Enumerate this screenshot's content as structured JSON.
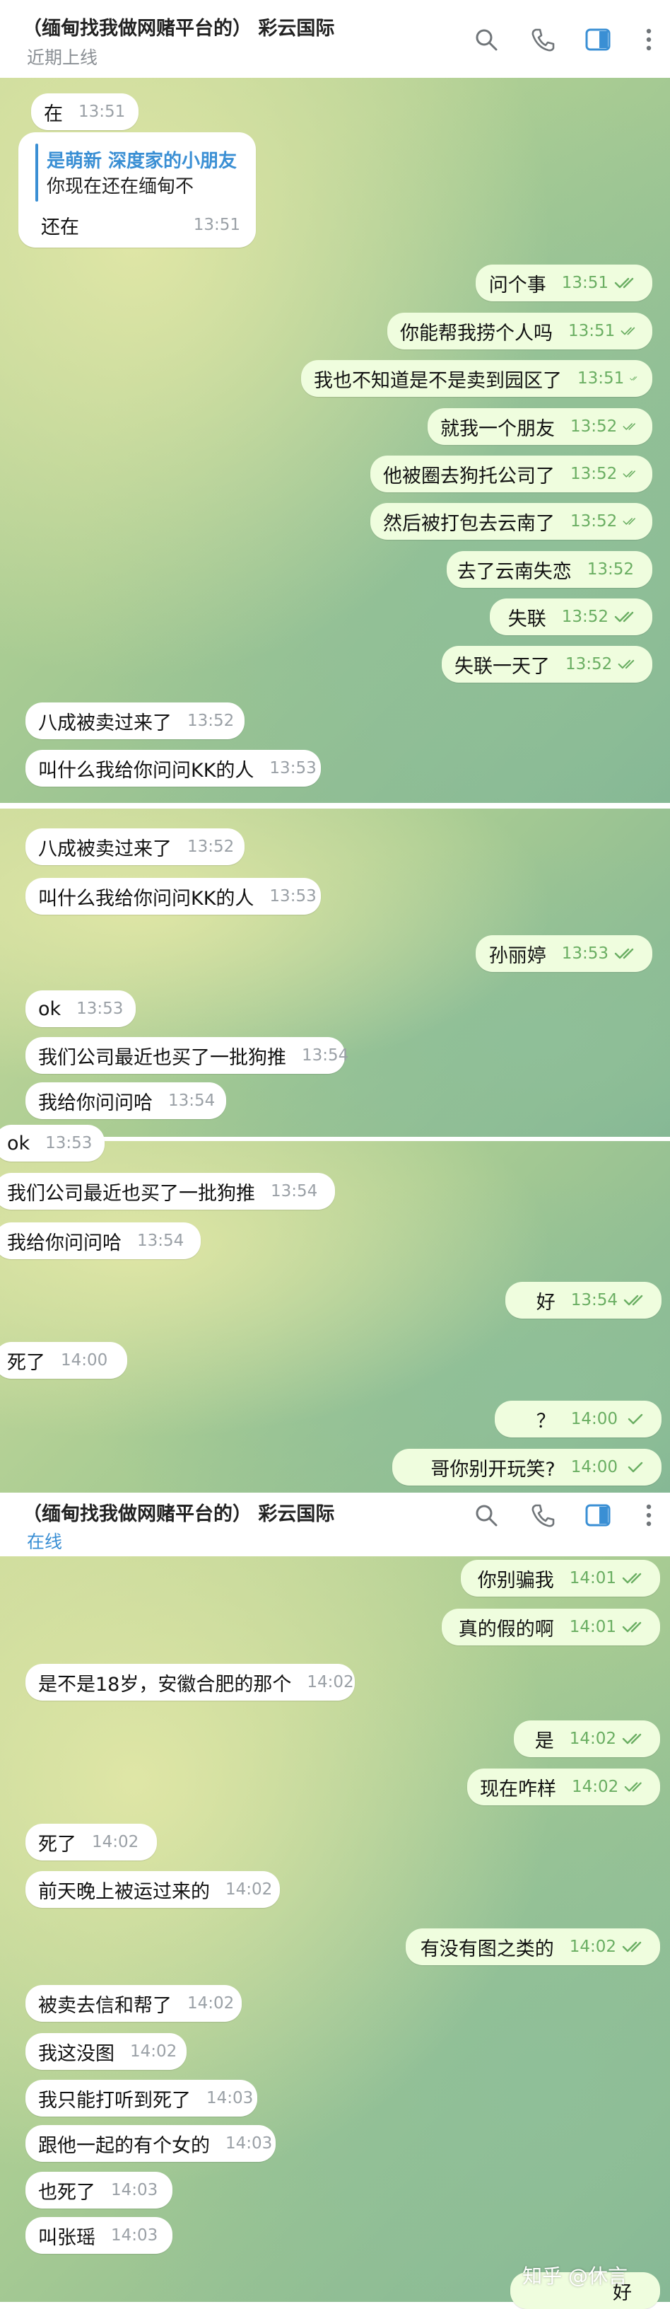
{
  "chat_title": "（缅甸找我做网赌平台的） 彩云国际",
  "status_top": "近期上线",
  "status_bottom": "在线",
  "header_icons": [
    "search-icon",
    "phone-icon",
    "sidebar-toggle-icon",
    "more-icon"
  ],
  "accent_color": "#3a8fd4",
  "reply_quote": {
    "name": "是萌新 深度家的小朋友",
    "text": "你现在还在缅甸不",
    "reply": "还在",
    "time": "13:51"
  },
  "seg1": [
    {
      "text": "在",
      "time": "13:51",
      "dir": "in"
    },
    {
      "text": "问个事",
      "time": "13:51",
      "dir": "out"
    },
    {
      "text": "你能帮我捞个人吗",
      "time": "13:51",
      "dir": "out"
    },
    {
      "text": "我也不知道是不是卖到园区了",
      "time": "13:51",
      "dir": "out"
    },
    {
      "text": "就我一个朋友",
      "time": "13:52",
      "dir": "out"
    },
    {
      "text": "他被圈去狗托公司了",
      "time": "13:52",
      "dir": "out"
    },
    {
      "text": "然后被打包去云南了",
      "time": "13:52",
      "dir": "out"
    },
    {
      "text": "去了云南失恋",
      "time": "13:52",
      "dir": "out"
    },
    {
      "text": "失联",
      "time": "13:52",
      "dir": "out"
    },
    {
      "text": "失联一天了",
      "time": "13:52",
      "dir": "out"
    },
    {
      "text": "八成被卖过来了",
      "time": "13:52",
      "dir": "in"
    },
    {
      "text": "叫什么我给你问问KK的人",
      "time": "13:53",
      "dir": "in"
    }
  ],
  "seg2": [
    {
      "text": "八成被卖过来了",
      "time": "13:52",
      "dir": "in"
    },
    {
      "text": "叫什么我给你问问KK的人",
      "time": "13:53",
      "dir": "in"
    },
    {
      "text": "孙丽婷",
      "time": "13:53",
      "dir": "out"
    },
    {
      "text": "ok",
      "time": "13:53",
      "dir": "in"
    },
    {
      "text": "我们公司最近也买了一批狗推",
      "time": "13:54",
      "dir": "in"
    },
    {
      "text": "我给你问问哈",
      "time": "13:54",
      "dir": "in"
    }
  ],
  "seg3": [
    {
      "text": "ok",
      "time": "13:53",
      "dir": "in"
    },
    {
      "text": "我们公司最近也买了一批狗推",
      "time": "13:54",
      "dir": "in"
    },
    {
      "text": "我给你问问哈",
      "time": "13:54",
      "dir": "in"
    },
    {
      "text": "好",
      "time": "13:54",
      "dir": "out"
    },
    {
      "text": "死了",
      "time": "14:00",
      "dir": "in"
    },
    {
      "text": "？",
      "time": "14:00",
      "dir": "out"
    },
    {
      "text": "哥你别开玩笑?",
      "time": "14:00",
      "dir": "out"
    }
  ],
  "seg4": [
    {
      "text": "你别骗我",
      "time": "14:01",
      "dir": "out"
    },
    {
      "text": "真的假的啊",
      "time": "14:01",
      "dir": "out"
    },
    {
      "text": "是不是18岁，安徽合肥的那个",
      "time": "14:02",
      "dir": "in"
    },
    {
      "text": "是",
      "time": "14:02",
      "dir": "out"
    },
    {
      "text": "现在咋样",
      "time": "14:02",
      "dir": "out"
    },
    {
      "text": "死了",
      "time": "14:02",
      "dir": "in"
    },
    {
      "text": "前天晚上被运过来的",
      "time": "14:02",
      "dir": "in"
    },
    {
      "text": "有没有图之类的",
      "time": "14:02",
      "dir": "out"
    },
    {
      "text": "被卖去信和帮了",
      "time": "14:02",
      "dir": "in"
    },
    {
      "text": "我这没图",
      "time": "14:02",
      "dir": "in"
    },
    {
      "text": "我只能打听到死了",
      "time": "14:03",
      "dir": "in"
    },
    {
      "text": "跟他一起的有个女的",
      "time": "14:03",
      "dir": "in"
    },
    {
      "text": "也死了",
      "time": "14:03",
      "dir": "in"
    },
    {
      "text": "叫张瑶",
      "time": "14:03",
      "dir": "in"
    },
    {
      "text": "好",
      "time": "",
      "dir": "out"
    }
  ],
  "watermark": "知乎 @休言"
}
